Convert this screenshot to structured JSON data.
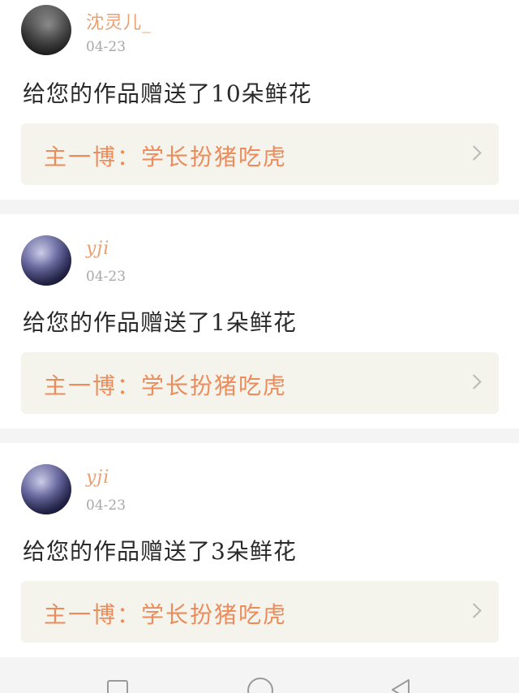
{
  "notifications": [
    {
      "username": "沈灵儿_",
      "date": "04-23",
      "message": "给您的作品赠送了10朵鲜花",
      "work_link": "主一博：学长扮猪吃虎"
    },
    {
      "username": "yji",
      "date": "04-23",
      "message": "给您的作品赠送了1朵鲜花",
      "work_link": "主一博：学长扮猪吃虎"
    },
    {
      "username": "yji",
      "date": "04-23",
      "message": "给您的作品赠送了3朵鲜花",
      "work_link": "主一博：学长扮猪吃虎"
    }
  ],
  "nav_bar": {
    "buttons": [
      "recent-apps",
      "home",
      "back"
    ]
  },
  "icons": {
    "chevron": "chevron-right-icon",
    "recent": "square-icon",
    "home": "circle-icon",
    "back": "triangle-back-icon"
  },
  "colors": {
    "username": "#e8a070",
    "link_text": "#ec8c5c",
    "link_bg": "#f4f4ec",
    "date": "#a8a8a8"
  }
}
